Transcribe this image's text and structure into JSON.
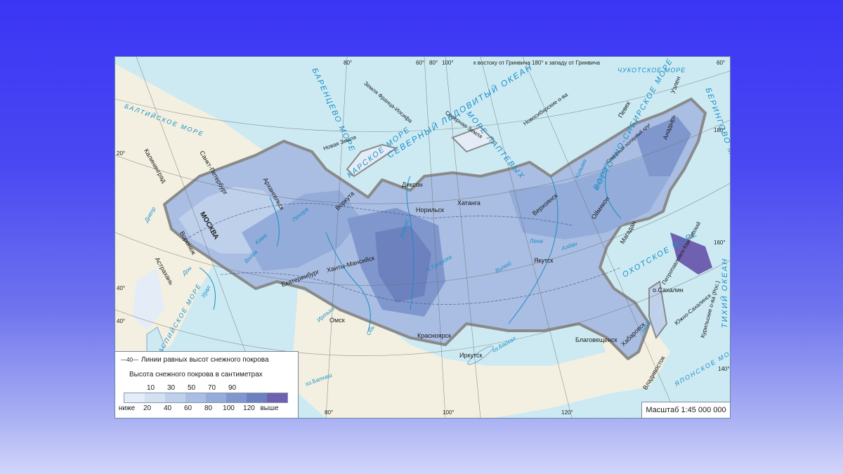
{
  "map": {
    "legend": {
      "isoline_sample": "—40—",
      "isoline_label": "Линии равных высот снежного покрова",
      "title": "Высота снежного покрова в сантиметрах",
      "top_values": [
        "10",
        "30",
        "50",
        "70",
        "90"
      ],
      "bottom_values": [
        "ниже",
        "20",
        "40",
        "60",
        "80",
        "100",
        "120",
        "выше"
      ],
      "swatch_colors": [
        "#e4edf7",
        "#d3e0f0",
        "#bfd0ea",
        "#a9bee2",
        "#94acd9",
        "#8097cd",
        "#6c81be",
        "#6f61b0"
      ]
    },
    "scale_label": "Масштаб 1:45 000 000",
    "meridian_note": "к востоку от Гринвича 180° к западу от Гринвича",
    "degrees": {
      "d80_top": "80°",
      "d60_top": "60°",
      "d80b_top": "80°",
      "d100_top": "100°",
      "d60_right": "60°",
      "d180_right": "180°",
      "d160_right": "160°",
      "d20_left": "20°",
      "d40_left": "40°",
      "d80_bottom": "80°",
      "d100_bottom": "100°",
      "d120_bottom": "120°",
      "d140_bottom": "140°",
      "d40_left2": "40°"
    },
    "seas": {
      "arctic": "СЕВЕРНЫЙ ЛЕДОВИТЫЙ ОКЕАН",
      "barents": "БАРЕНЦЕВО МОРЕ",
      "kara": "КАРСКОЕ МОРЕ",
      "laptev": "МОРЕ ЛАПТЕВЫХ",
      "east_siberian": "ВОСТОЧНО-СИБИРСКОЕ МОРЕ",
      "chukchi": "ЧУКОТСКОЕ МОРЕ",
      "bering": "БЕРИНГОВО МОРЕ",
      "okhotsk": "ОХОТСКОЕ МОРЕ",
      "japan": "ЯПОНСКОЕ МОРЕ",
      "pacific": "ТИХИЙ ОКЕАН",
      "caspian": "КАСПИЙСКОЕ МОРЕ",
      "baltic": "БАЛТИЙСКОЕ МОРЕ"
    },
    "cities": {
      "kaliningrad": "Калининград",
      "spb": "Санкт-Петербург",
      "moscow": "МОСКВА",
      "voronezh": "Воронеж",
      "astrakhan": "Астрахань",
      "arkhangelsk": "Архангельск",
      "vorkuta": "Воркута",
      "dikson": "Диксон",
      "norilsk": "Норильск",
      "khatanga": "Хатанга",
      "verkhoyansk": "Верхоянск",
      "oymyakon": "Оймякон",
      "pevek": "Певек",
      "anadyr": "Анадырь",
      "uelen": "Уэлен",
      "magadan": "Магадан",
      "petropavlovsk": "Петропавловск-Камчатский",
      "yakutsk": "Якутск",
      "khanty": "Ханты-Мансийск",
      "yekaterinburg": "Екатеринбург",
      "omsk": "Омск",
      "krasnoyarsk": "Красноярск",
      "irkutsk": "Иркутск",
      "blagoveshchensk": "Благовещенск",
      "khabarovsk": "Хабаровск",
      "yuzhno": "Южно-Сахалинск",
      "vladivostok": "Владивосток"
    },
    "islands": {
      "franz_josef": "Земля Франца-Иосифа",
      "novaya_zemlya": "Новая Земля",
      "severnaya_zemlya": "Северная Земля",
      "novosibirsk": "Новосибирские о-ва",
      "sakhalin": "о.Сахалин",
      "kuril": "Курильские о-ва (Рос.)",
      "balkhash": "оз.Балхаш"
    },
    "rivers": {
      "pechora": "Печора",
      "ob": "Обь",
      "yenisei": "Енисей",
      "lena": "Лена",
      "kolyma": "Колыма",
      "indigirka": "Индигирка",
      "vilyuy": "Вилюй",
      "aldan": "Алдан",
      "volga": "Волга",
      "irtysh": "Иртыш",
      "ural": "Урал",
      "amur": "Амур",
      "baikal": "оз.Байкал",
      "tunguska": "Н.Тунгуска",
      "kama": "Кама",
      "don": "Дон",
      "dnepr": "Днепр"
    },
    "polar_circle": "Северный полярный круг"
  }
}
